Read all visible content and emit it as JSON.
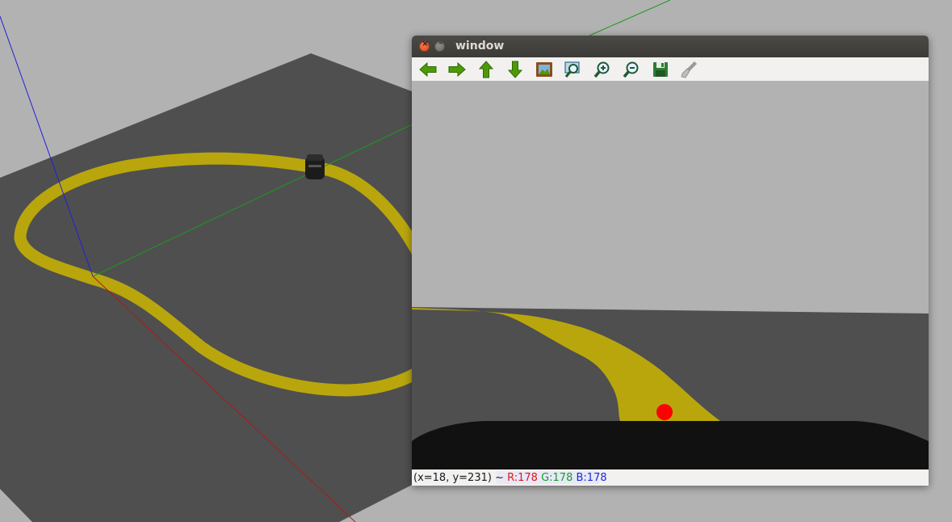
{
  "window": {
    "title": "window",
    "close_glyph": "×",
    "minimize_glyph": "–"
  },
  "toolbar": {
    "tools": [
      "arrow-left-icon",
      "arrow-right-icon",
      "arrow-up-icon",
      "arrow-down-icon",
      "picture-icon",
      "zoom-fit-icon",
      "zoom-in-icon",
      "zoom-out-icon",
      "save-icon",
      "properties-icon"
    ]
  },
  "status": {
    "coords": "(x=18, y=231) ~",
    "r": "R:178",
    "g": "G:178",
    "b": "B:178"
  },
  "colors": {
    "track": "#b9a60d",
    "ground": "#4f4f4f",
    "sky": "#b2b2b2",
    "marker": "#ff0000",
    "icon_green": "#4e9a06"
  }
}
